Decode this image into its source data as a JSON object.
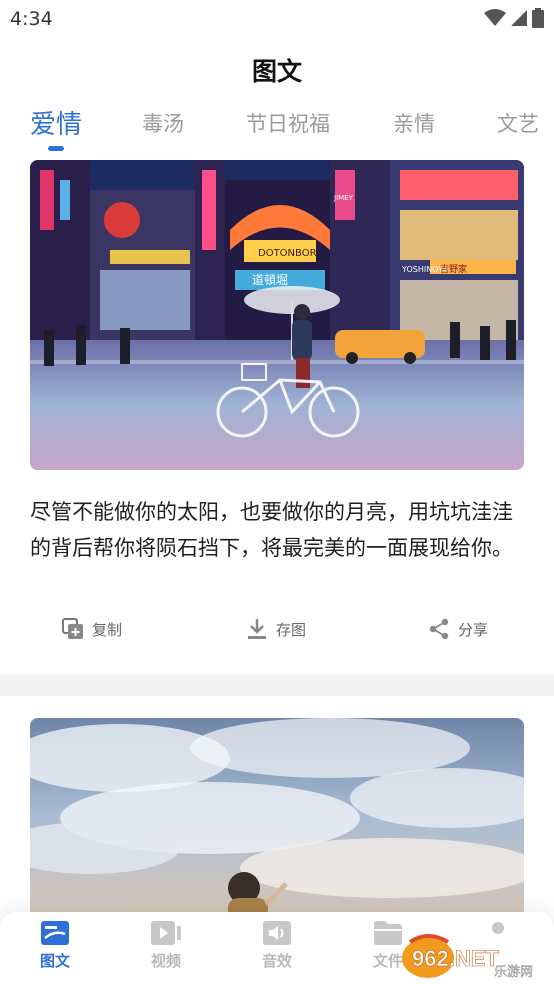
{
  "status_bar": {
    "time": "4:34"
  },
  "page": {
    "title": "图文"
  },
  "tabs": [
    {
      "label": "爱情",
      "active": true
    },
    {
      "label": "毒汤",
      "active": false
    },
    {
      "label": "节日祝福",
      "active": false
    },
    {
      "label": "亲情",
      "active": false
    },
    {
      "label": "文艺",
      "active": false
    }
  ],
  "cards": [
    {
      "text": "尽管不能做你的太阳，也要做你的月亮，用坑坑洼洼的背后帮你将陨石挡下，将最完美的一面展现给你。",
      "image_signs": [
        "DOTONBORI",
        "道頓堀",
        "YOSHINOYA",
        "吉野家",
        "JIMEY"
      ],
      "actions": {
        "copy": "复制",
        "save": "存图",
        "share": "分享"
      }
    },
    {
      "text": "",
      "image_signs": []
    }
  ],
  "bottom_nav": [
    {
      "label": "图文",
      "icon": "image-text-icon",
      "active": true
    },
    {
      "label": "视频",
      "icon": "video-icon",
      "active": false
    },
    {
      "label": "音效",
      "icon": "sound-icon",
      "active": false
    },
    {
      "label": "文件",
      "icon": "folder-icon",
      "active": false
    }
  ],
  "watermark": {
    "brand": "962.NET",
    "sub": "乐游网"
  },
  "colors": {
    "accent": "#2f6fd8",
    "inactive": "#9a9a9a",
    "divider": "#f2f2f2"
  }
}
